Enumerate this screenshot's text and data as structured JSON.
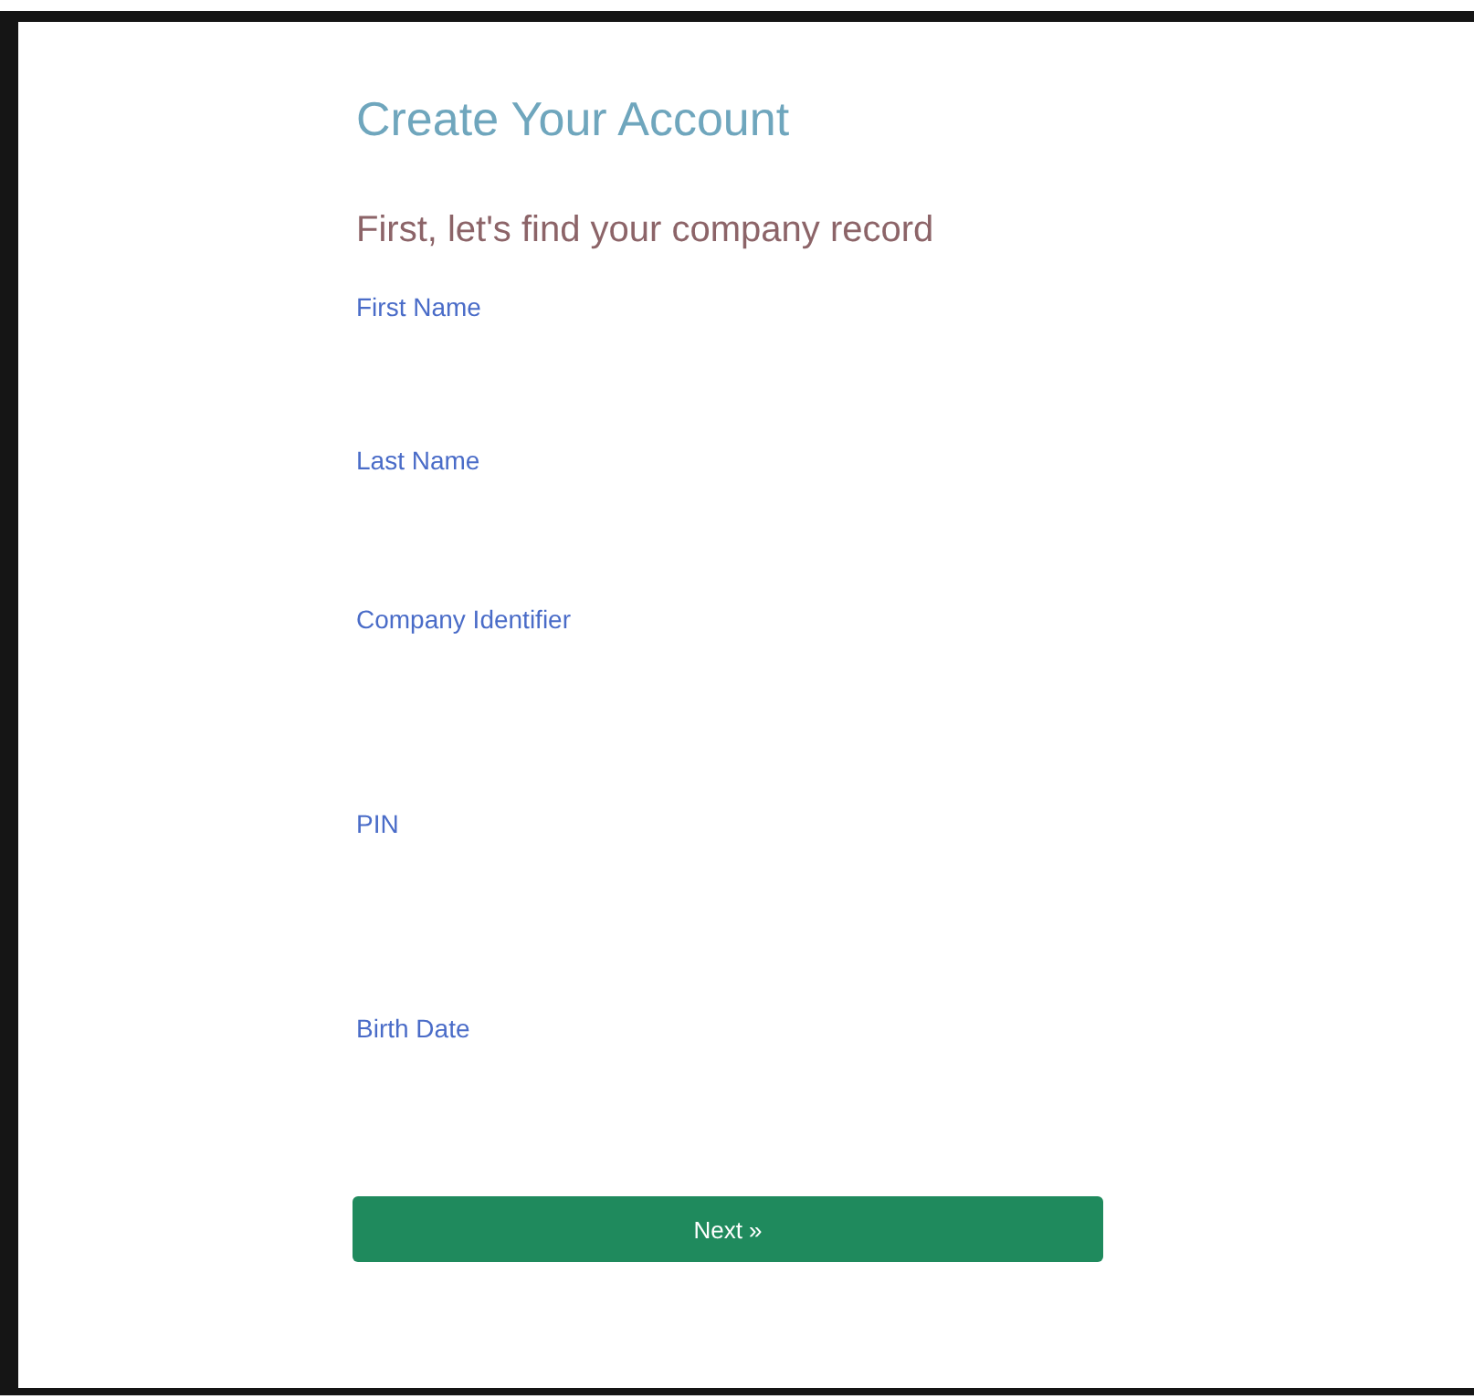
{
  "title": "Create Your Account",
  "subtitle": "First, let's find your company record",
  "fields": [
    {
      "label": "First Name"
    },
    {
      "label": "Last Name"
    },
    {
      "label": "Company Identifier"
    },
    {
      "label": "PIN"
    },
    {
      "label": "Birth Date"
    }
  ],
  "button": {
    "label": "Next »"
  }
}
